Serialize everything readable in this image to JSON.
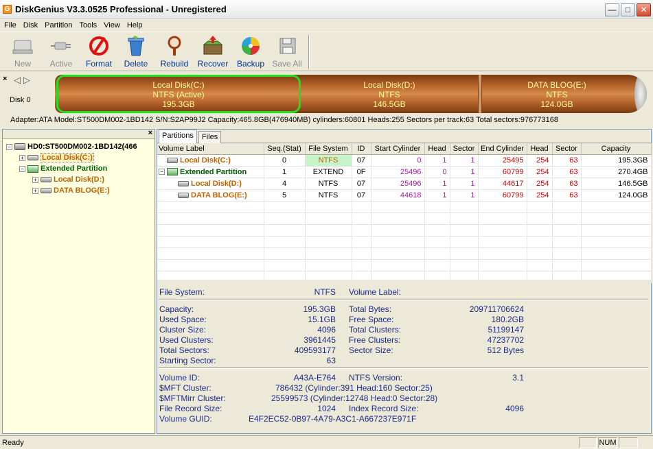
{
  "window": {
    "title": "DiskGenius V3.3.0525 Professional - Unregistered",
    "app_icon_letter": "G"
  },
  "menu": [
    "File",
    "Disk",
    "Partition",
    "Tools",
    "View",
    "Help"
  ],
  "toolbar": {
    "buttons": [
      {
        "label": "New",
        "icon": "new-disk-icon",
        "enabled": false
      },
      {
        "label": "Active",
        "icon": "active-plug-icon",
        "enabled": false
      },
      {
        "label": "Format",
        "icon": "format-icon",
        "enabled": true
      },
      {
        "label": "Delete",
        "icon": "trash-icon",
        "enabled": true
      },
      {
        "label": "Rebuild",
        "icon": "magnifier-icon",
        "enabled": true
      },
      {
        "label": "Recover",
        "icon": "recover-box-icon",
        "enabled": true
      },
      {
        "label": "Backup",
        "icon": "backup-disc-icon",
        "enabled": true
      },
      {
        "label": "Save All",
        "icon": "save-all-icon",
        "enabled": false
      }
    ]
  },
  "diskmap": {
    "disk_label": "Disk  0",
    "partitions": [
      {
        "name": "Local Disk(C:)",
        "fs": "NTFS (Active)",
        "size": "195.3GB",
        "active": true
      },
      {
        "name": "Local Disk(D:)",
        "fs": "NTFS",
        "size": "146.5GB",
        "active": false
      },
      {
        "name": "DATA BLOG(E:)",
        "fs": "NTFS",
        "size": "124.0GB",
        "active": false
      }
    ]
  },
  "adapter_info": "Adapter:ATA  Model:ST500DM002-1BD142  S/N:S2AP99J2  Capacity:465.8GB(476940MB)  cylinders:60801  Heads:255  Sectors per track:63  Total sectors:976773168",
  "tree": {
    "disk": "HD0:ST500DM002-1BD142(466",
    "items": [
      {
        "label": "Local Disk(C:)",
        "level": 1,
        "expander": "+",
        "type": "primary",
        "selected": true
      },
      {
        "label": "Extended Partition",
        "level": 1,
        "expander": "−",
        "type": "extended",
        "selected": false
      },
      {
        "label": "Local Disk(D:)",
        "level": 2,
        "expander": "+",
        "type": "logical",
        "selected": false
      },
      {
        "label": "DATA BLOG(E:)",
        "level": 2,
        "expander": "+",
        "type": "logical",
        "selected": false
      }
    ]
  },
  "tabs": [
    "Partitions",
    "Files"
  ],
  "partition_table": {
    "columns": [
      "Volume Label",
      "Seq.(Stat)",
      "File System",
      "ID",
      "Start Cylinder",
      "Head",
      "Sector",
      "End Cylinder",
      "Head",
      "Sector",
      "Capacity"
    ],
    "rows": [
      {
        "label": "Local Disk(C:)",
        "seq": "0",
        "fs": "NTFS",
        "id": "07",
        "start_cyl": "0",
        "start_head": "1",
        "start_sector": "1",
        "end_cyl": "25495",
        "end_head": "254",
        "end_sector": "63",
        "capacity": "195.3GB"
      },
      {
        "label": "Extended Partition",
        "seq": "1",
        "fs": "EXTEND",
        "id": "0F",
        "start_cyl": "25496",
        "start_head": "0",
        "start_sector": "1",
        "end_cyl": "60799",
        "end_head": "254",
        "end_sector": "63",
        "capacity": "270.4GB"
      },
      {
        "label": "Local Disk(D:)",
        "seq": "4",
        "fs": "NTFS",
        "id": "07",
        "start_cyl": "25496",
        "start_head": "1",
        "start_sector": "1",
        "end_cyl": "44617",
        "end_head": "254",
        "end_sector": "63",
        "capacity": "146.5GB"
      },
      {
        "label": "DATA BLOG(E:)",
        "seq": "5",
        "fs": "NTFS",
        "id": "07",
        "start_cyl": "44618",
        "start_head": "1",
        "start_sector": "1",
        "end_cyl": "60799",
        "end_head": "254",
        "end_sector": "63",
        "capacity": "124.0GB"
      }
    ]
  },
  "details": {
    "file_system": {
      "label": "File System:",
      "value": "NTFS"
    },
    "volume_label": {
      "label": "Volume Label:",
      "value": ""
    },
    "left": [
      {
        "label": "Capacity:",
        "value": "195.3GB"
      },
      {
        "label": "Used Space:",
        "value": "15.1GB"
      },
      {
        "label": "Cluster Size:",
        "value": "4096"
      },
      {
        "label": "Used Clusters:",
        "value": "3961445"
      },
      {
        "label": "Total Sectors:",
        "value": "409593177"
      },
      {
        "label": "Starting Sector:",
        "value": "63"
      }
    ],
    "right": [
      {
        "label": "Total Bytes:",
        "value": "209711706624"
      },
      {
        "label": "Free Space:",
        "value": "180.2GB"
      },
      {
        "label": "Total Clusters:",
        "value": "51199147"
      },
      {
        "label": "Free Clusters:",
        "value": "47237702"
      },
      {
        "label": "Sector Size:",
        "value": "512 Bytes"
      }
    ],
    "volume_id": {
      "label": "Volume ID:",
      "value": "A43A-E764"
    },
    "ntfs_version": {
      "label": "NTFS Version:",
      "value": "3.1"
    },
    "mft_cluster": {
      "label": "$MFT Cluster:",
      "value": "786432 (Cylinder:391 Head:160 Sector:25)"
    },
    "mftmirr_cluster": {
      "label": "$MFTMirr Cluster:",
      "value": "25599573 (Cylinder:12748 Head:0 Sector:28)"
    },
    "file_record_size": {
      "label": "File Record Size:",
      "value": "1024"
    },
    "index_record_size": {
      "label": "Index Record Size:",
      "value": "4096"
    },
    "volume_guid": {
      "label": "Volume GUID:",
      "value": "E4F2EC52-0B97-4A79-A3C1-A667237E971F"
    }
  },
  "statusbar": {
    "text": "Ready",
    "num": "NUM"
  }
}
